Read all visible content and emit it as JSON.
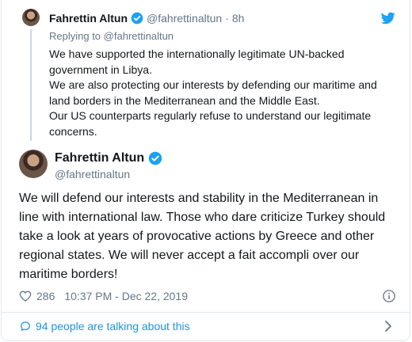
{
  "parent_tweet": {
    "name": "Fahrettin Altun",
    "handle": "@fahrettinaltun",
    "separator": "·",
    "time": "8h",
    "replying_label": "Replying to",
    "replying_to": "@fahrettinaltun",
    "paragraphs": [
      "We have supported the internationally legitimate UN-backed government in Libya.",
      "We are also protecting our interests by defending our maritime and land borders in the Mediterranean and the Middle East.",
      "Our US counterparts regularly refuse to understand our legitimate concerns."
    ]
  },
  "main_tweet": {
    "name": "Fahrettin Altun",
    "handle": "@fahrettinaltun",
    "text": "We will defend our interests and stability in the Mediterranean in line with international law. Those who dare criticize Turkey should take a look at years of provocative actions by Greece and other regional states. We will never accept a fait accompli over our maritime borders!",
    "likes": "286",
    "timestamp": "10:37 PM - Dec 22, 2019"
  },
  "footer": {
    "talking_label": "94 people are talking about this"
  },
  "icons": {
    "verified": "verified-badge-icon",
    "bird": "twitter-bird-icon",
    "heart": "heart-icon",
    "info": "info-icon",
    "bubble": "comment-bubble-icon",
    "chevron": "chevron-right-icon"
  },
  "colors": {
    "accent": "#1da1f2",
    "link": "#1b95e0",
    "muted": "#657786",
    "text": "#14171a",
    "border": "#e1e8ed"
  }
}
